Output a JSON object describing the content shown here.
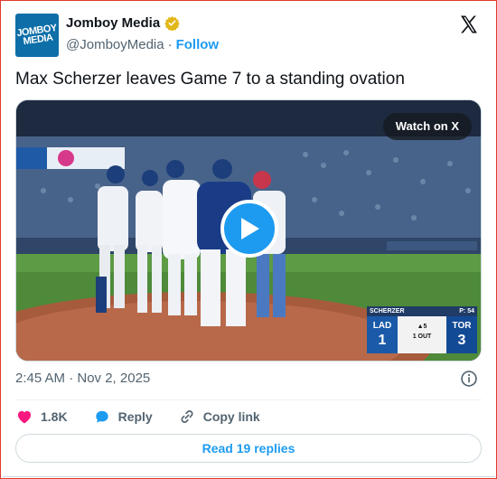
{
  "author": {
    "display_name": "Jomboy Media",
    "handle": "@JomboyMedia",
    "separator": "·",
    "follow_label": "Follow",
    "avatar_text_line1": "JOMBOY",
    "avatar_text_line2": "MEDIA"
  },
  "tweet": {
    "text": "Max Scherzer leaves Game 7 to a standing ovation",
    "timestamp": "2:45 AM · Nov 2, 2025"
  },
  "media": {
    "watch_label": "Watch on X",
    "scorebug": {
      "pitcher": "SCHERZER",
      "pitch_count": "P: 54",
      "away_team": "LAD",
      "away_score": "1",
      "home_team": "TOR",
      "home_score": "3",
      "inning": "▲5",
      "outs": "1 OUT"
    }
  },
  "actions": {
    "likes": "1.8K",
    "reply_label": "Reply",
    "copy_link_label": "Copy link"
  },
  "replies_button_label": "Read 19 replies",
  "colors": {
    "brand_blue": "#1d9bf0",
    "like_pink": "#f91880",
    "verified_gold": "#e2b719",
    "text_secondary": "#536471"
  },
  "icons": [
    "x-logo-icon",
    "verified-badge-icon",
    "play-icon",
    "info-icon",
    "heart-icon",
    "reply-bubble-icon",
    "link-icon"
  ]
}
